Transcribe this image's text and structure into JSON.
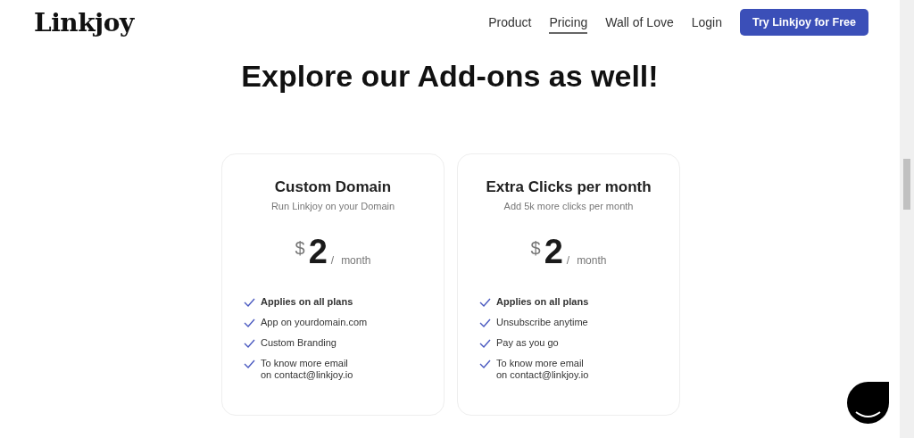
{
  "header": {
    "logo": "Linkjoy",
    "nav": [
      {
        "label": "Product",
        "selected": false
      },
      {
        "label": "Pricing",
        "selected": true
      },
      {
        "label": "Wall of Love",
        "selected": false
      },
      {
        "label": "Login",
        "selected": false
      }
    ],
    "cta": "Try Linkjoy for Free"
  },
  "title": "Explore our Add-ons as well!",
  "addons": [
    {
      "name": "Custom Domain",
      "subtitle": "Run Linkjoy on your Domain",
      "currency": "$",
      "price": "2",
      "period": "/",
      "unit": "month",
      "features": [
        {
          "text": "Applies on all plans",
          "emphasis": true
        },
        {
          "text": "App on yourdomain.com",
          "emphasis": false
        },
        {
          "text": "Custom Branding",
          "emphasis": false
        },
        {
          "text": "To know more email\non contact@linkjoy.io",
          "emphasis": false
        }
      ]
    },
    {
      "name": "Extra Clicks per month",
      "subtitle": "Add 5k more clicks per month",
      "currency": "$",
      "price": "2",
      "period": "/",
      "unit": "month",
      "features": [
        {
          "text": "Applies on all plans",
          "emphasis": true
        },
        {
          "text": "Unsubscribe anytime",
          "emphasis": false
        },
        {
          "text": "Pay as you go",
          "emphasis": false
        },
        {
          "text": "To know more email\non contact@linkjoy.io",
          "emphasis": false
        }
      ]
    }
  ]
}
